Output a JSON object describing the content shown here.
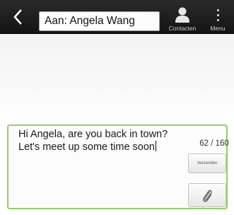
{
  "header": {
    "recipient_label": "Aan: Angela Wang",
    "contacts_label": "Contacten",
    "menu_label": "Menu",
    "bar_color": "#1c1c1c"
  },
  "compose": {
    "message_line1": "Hi Angela, are you back in town?",
    "message_line2": "Let's meet up some time soon",
    "char_count": "62 / 160",
    "send_label": "Verzenden",
    "border_color": "#95cc6a"
  },
  "icons": [
    "back-arrow-icon",
    "person-icon",
    "overflow-menu-icon",
    "paperclip-icon"
  ]
}
